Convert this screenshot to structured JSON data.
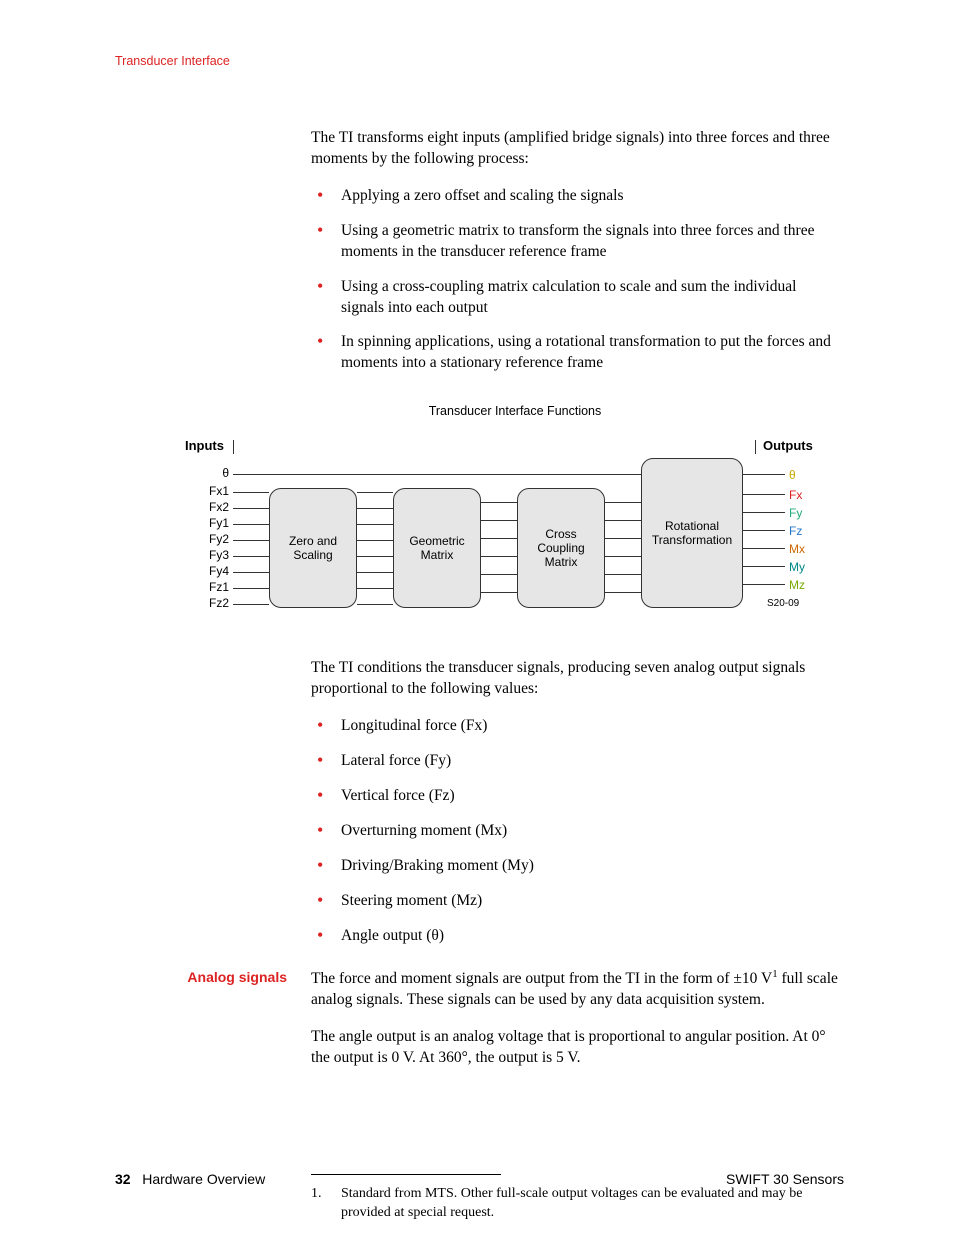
{
  "header": {
    "title": "Transducer Interface"
  },
  "intro": "The TI transforms eight inputs (amplified bridge signals) into three forces and three moments by the following process:",
  "process_bullets": [
    "Applying a zero offset and scaling the signals",
    "Using a geometric matrix to transform the signals into three forces and three moments in the transducer reference frame",
    "Using a cross-coupling matrix calculation to scale and sum the individual signals into each output",
    "In spinning applications, using a rotational transformation to put the forces and moments into a stationary reference frame"
  ],
  "diagram": {
    "title": "Transducer Interface Functions",
    "inputs_label": "Inputs",
    "outputs_label": "Outputs",
    "ref": "S20-09",
    "inputs": [
      "θ",
      "Fx1",
      "Fx2",
      "Fy1",
      "Fy2",
      "Fy3",
      "Fy4",
      "Fz1",
      "Fz2"
    ],
    "blocks": [
      "Zero and Scaling",
      "Geometric Matrix",
      "Cross Coupling Matrix",
      "Rotational Transformation"
    ],
    "outputs": [
      {
        "text": "θ",
        "cls": "out-theta"
      },
      {
        "text": "Fx",
        "cls": "out-fx"
      },
      {
        "text": "Fy",
        "cls": "out-fy"
      },
      {
        "text": "Fz",
        "cls": "out-fz"
      },
      {
        "text": "Mx",
        "cls": "out-mx"
      },
      {
        "text": "My",
        "cls": "out-my"
      },
      {
        "text": "Mz",
        "cls": "out-mz"
      }
    ]
  },
  "conditions_para": "The TI conditions the transducer signals, producing seven analog output signals proportional to the following values:",
  "value_bullets": [
    "Longitudinal force (Fx)",
    "Lateral force (Fy)",
    "Vertical force (Fz)",
    "Overturning moment (Mx)",
    "Driving/Braking moment (My)",
    "Steering moment (Mz)",
    "Angle output (θ)"
  ],
  "section": {
    "label": "Analog signals",
    "para1_a": "The force and moment signals are output from the TI in the form of ±10 V",
    "para1_sup": "1",
    "para1_b": " full scale analog signals. These signals can be used by any data acquisition system.",
    "para2": "The angle output is an analog voltage that is proportional to angular position. At 0° the output is 0 V. At 360°, the output is 5 V."
  },
  "footnote": {
    "num": "1.",
    "text": "Standard from MTS. Other full-scale output voltages can be evaluated and may be provided at special request."
  },
  "footer": {
    "page": "32",
    "left": "Hardware Overview",
    "right": "SWIFT 30 Sensors"
  }
}
